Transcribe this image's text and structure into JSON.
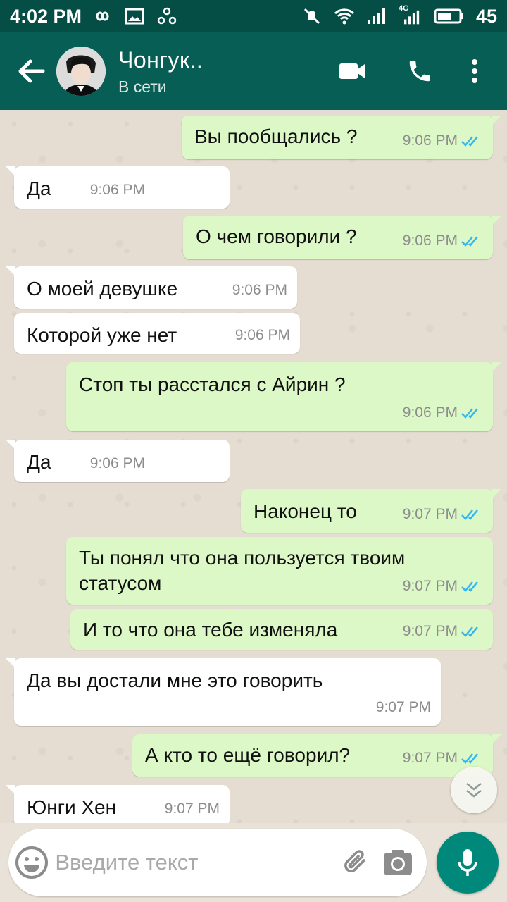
{
  "status_bar": {
    "time": "4:02 PM",
    "battery": "45",
    "network_type": "4G"
  },
  "header": {
    "contact_name": "Чонгук..",
    "contact_status": "В сети"
  },
  "messages": [
    {
      "dir": "out",
      "text": "Вы пообщались ?",
      "time": "9:06 PM"
    },
    {
      "dir": "in",
      "text": "Да",
      "time": "9:06 PM"
    },
    {
      "dir": "out",
      "text": "О чем говорили ?",
      "time": "9:06 PM"
    },
    {
      "dir": "in",
      "text": "О моей девушке",
      "time": "9:06 PM"
    },
    {
      "dir": "in",
      "text": "Которой уже нет",
      "time": "9:06 PM"
    },
    {
      "dir": "out",
      "text": "Стоп ты расстался с Айрин ?",
      "time": "9:06 PM"
    },
    {
      "dir": "in",
      "text": "Да",
      "time": "9:06 PM"
    },
    {
      "dir": "out",
      "text": "Наконец то",
      "time": "9:07 PM"
    },
    {
      "dir": "out",
      "text": "Ты понял что она пользуется твоим статусом",
      "time": "9:07 PM"
    },
    {
      "dir": "out",
      "text": "И то что она тебе изменяла",
      "time": "9:07 PM"
    },
    {
      "dir": "in",
      "text": "Да вы достали мне это говорить",
      "time": "9:07 PM"
    },
    {
      "dir": "out",
      "text": "А кто то ещё говорил?",
      "time": "9:07 PM"
    },
    {
      "dir": "in",
      "text": "Юнги Хен",
      "time": "9:07 PM"
    }
  ],
  "composer": {
    "placeholder": "Введите текст"
  },
  "colors": {
    "header": "#075e54",
    "status_bar": "#044e46",
    "outgoing_bubble": "#dcf8c6",
    "incoming_bubble": "#ffffff",
    "read_ticks": "#34b7f1",
    "mic_button": "#00897b"
  },
  "icons": {
    "back": "arrow-left-icon",
    "video_call": "video-camera-icon",
    "voice_call": "phone-icon",
    "menu": "more-vert-icon",
    "emoji": "smiley-icon",
    "attach": "paperclip-icon",
    "camera": "camera-icon",
    "mic": "microphone-icon",
    "scroll_down": "double-chevron-down-icon"
  }
}
